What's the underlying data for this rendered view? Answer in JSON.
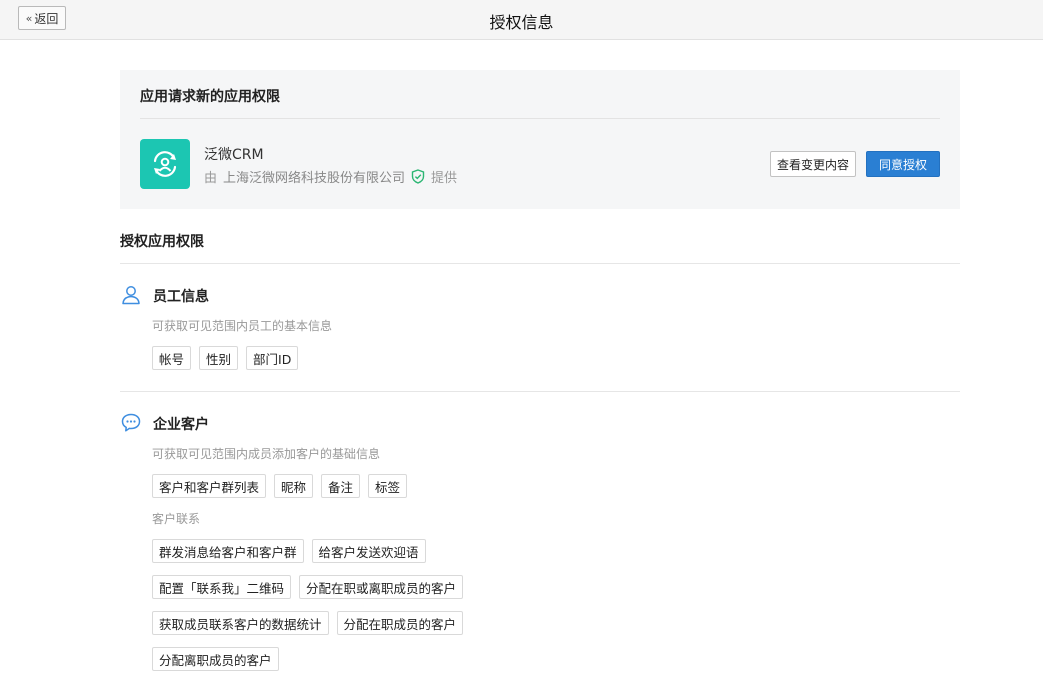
{
  "header": {
    "back_label": "返回",
    "title": "授权信息"
  },
  "request": {
    "title": "应用请求新的应用权限",
    "app_name": "泛微CRM",
    "provider_prefix": "由",
    "provider_name": "上海泛微网络科技股份有限公司",
    "provider_suffix": "提供",
    "view_changes_label": "查看变更内容",
    "approve_label": "同意授权"
  },
  "permissions": {
    "title": "授权应用权限",
    "groups": [
      {
        "title": "员工信息",
        "icon": "user-icon",
        "description": "可获取可见范围内员工的基本信息",
        "tags": [
          "帐号",
          "性别",
          "部门ID"
        ]
      },
      {
        "title": "企业客户",
        "icon": "chat-bubble-icon",
        "description": "可获取可见范围内成员添加客户的基础信息",
        "tags": [
          "客户和客户群列表",
          "昵称",
          "备注",
          "标签"
        ],
        "subgroup": {
          "label": "客户联系",
          "rows": [
            [
              "群发消息给客户和客户群",
              "给客户发送欢迎语"
            ],
            [
              "配置「联系我」二维码",
              "分配在职或离职成员的客户"
            ],
            [
              "获取成员联系客户的数据统计",
              "分配在职成员的客户"
            ],
            [
              "分配离职成员的客户"
            ]
          ]
        }
      }
    ]
  },
  "colors": {
    "accent": "#2a7fd3",
    "app_icon_bg": "#1cc6b2",
    "verified_green": "#2bb673"
  }
}
